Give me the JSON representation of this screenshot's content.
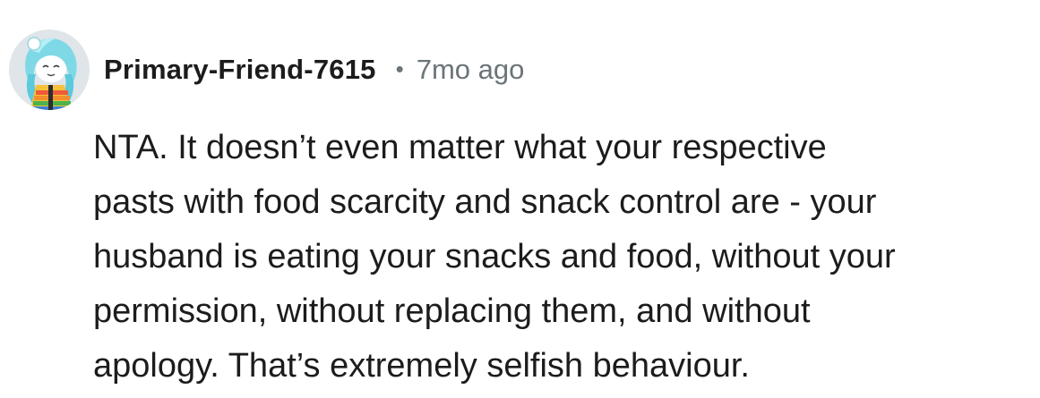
{
  "comment": {
    "author": "Primary-Friend-7615",
    "separator": "•",
    "timestamp": "7mo ago",
    "avatar_icon": "user-avatar-icon",
    "body_lines": [
      "NTA. It doesn’t even matter what your respective",
      "pasts with food scarcity and snack control are - your",
      "husband is eating your snacks and food, without your",
      "permission, without replacing them, and without",
      "apology. That’s extremely selfish behaviour."
    ]
  },
  "colors": {
    "text": "#1c1c1c",
    "meta": "#6b7479",
    "avatar_bg": "#dfe5e8"
  }
}
